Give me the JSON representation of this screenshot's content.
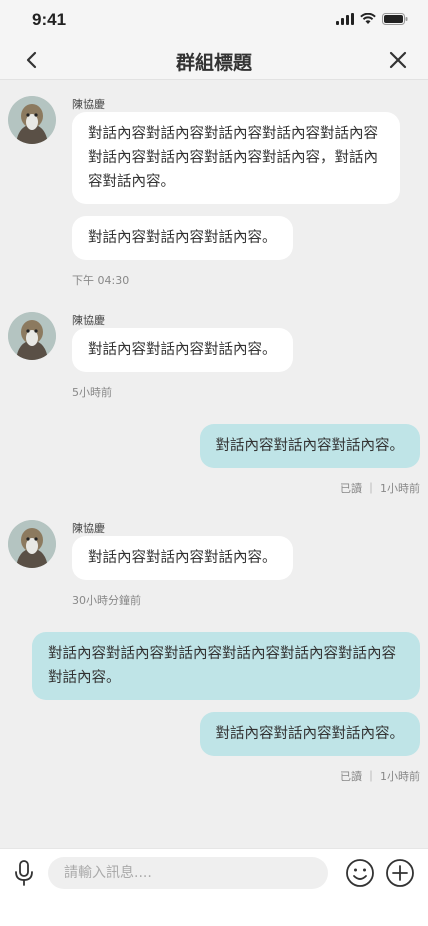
{
  "status_bar": {
    "time": "9:41"
  },
  "header": {
    "title": "群組標題"
  },
  "messages": [
    {
      "sender": "陳協慶",
      "bubbles": [
        "對話內容對話內容對話內容對話內容對話內容對話內容對話內容對話內容對話內容，對話內容對話內容。",
        "對話內容對話內容對話內容。"
      ],
      "meta": "下午 04:30"
    },
    {
      "sender": "陳協慶",
      "bubbles": [
        "對話內容對話內容對話內容。"
      ],
      "meta": "5小時前"
    },
    {
      "bubbles": [
        "對話內容對話內容對話內容。"
      ],
      "meta": "已讀 ｜ 1小時前"
    },
    {
      "sender": "陳協慶",
      "bubbles": [
        "對話內容對話內容對話內容。"
      ],
      "meta": "30小時分鐘前"
    },
    {
      "bubbles": [
        "對話內容對話內容對話內容對話內容對話內容對話內容對話內容。",
        "對話內容對話內容對話內容。"
      ],
      "meta": "已讀 ｜ 1小時前"
    }
  ],
  "composer": {
    "placeholder": "請輸入訊息...."
  },
  "colors": {
    "outgoing_bubble": "#bfe4e7",
    "incoming_bubble": "#ffffff",
    "background": "#efefef"
  },
  "icons": [
    "back-chevron-icon",
    "close-icon",
    "mic-icon",
    "emoji-icon",
    "plus-icon",
    "signal-icon",
    "wifi-icon",
    "battery-icon"
  ]
}
